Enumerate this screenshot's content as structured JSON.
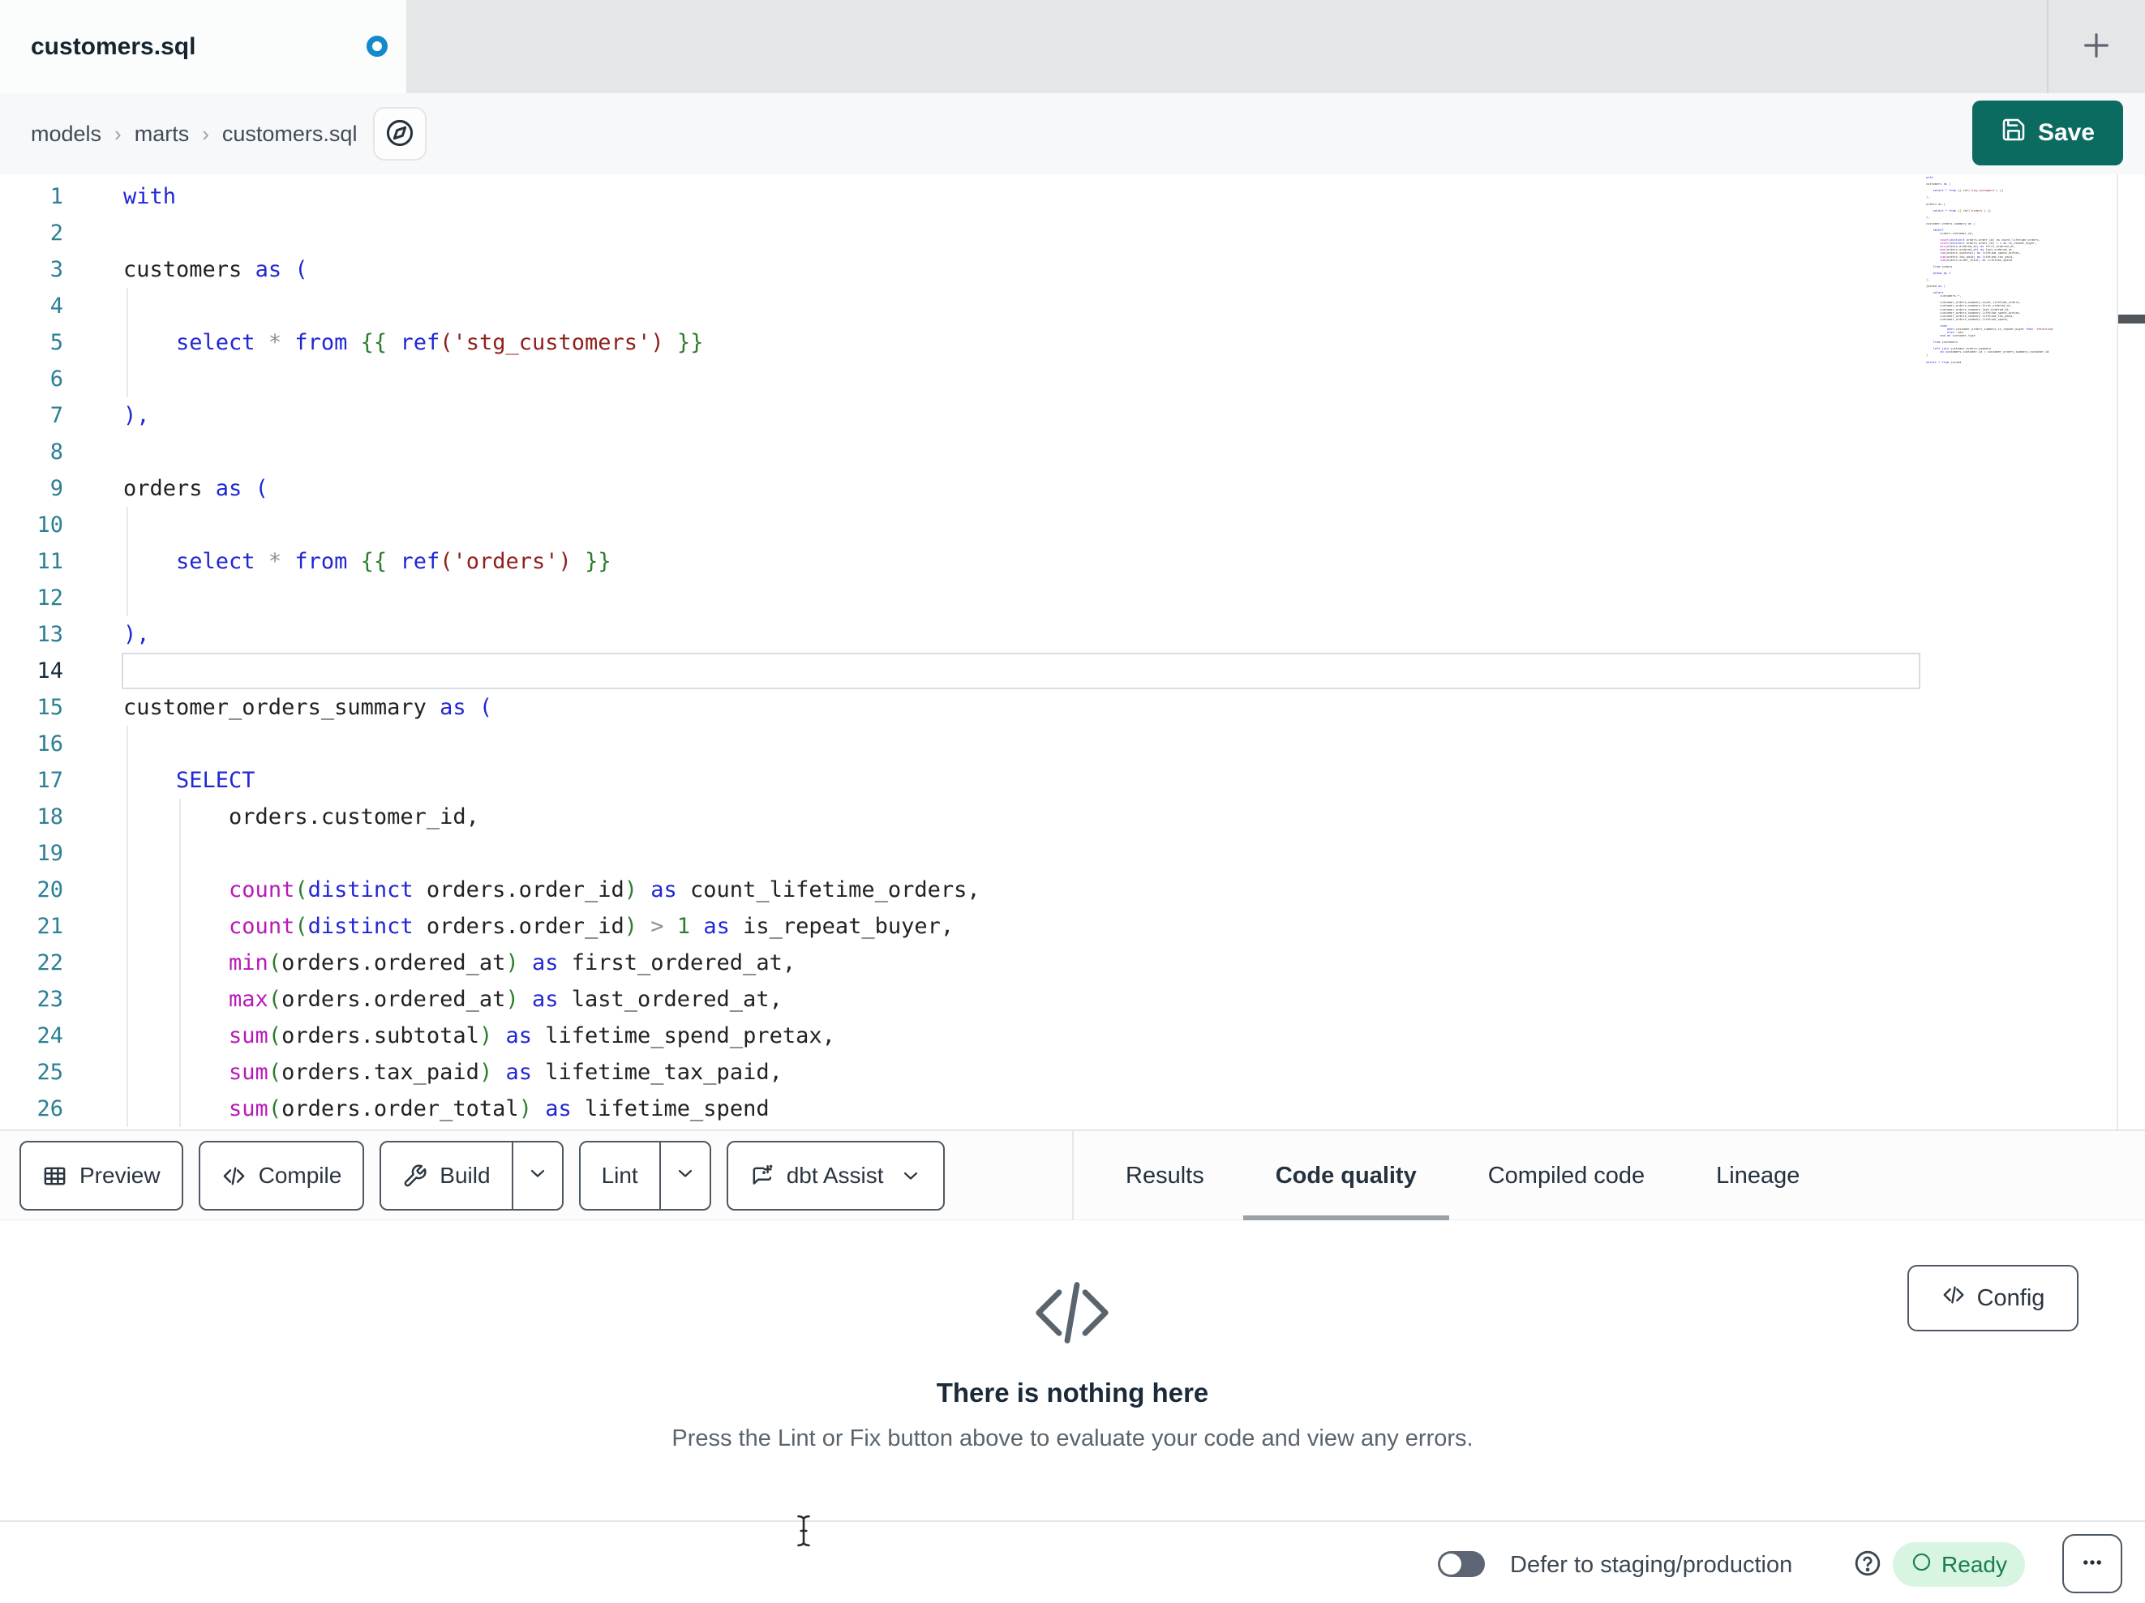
{
  "tab": {
    "title": "customers.sql",
    "dirty": true
  },
  "tabbar": {
    "new_tab_icon": "plus-icon"
  },
  "breadcrumb": {
    "items": [
      "models",
      "marts",
      "customers.sql"
    ],
    "separator": "›",
    "explore_icon": "compass-icon"
  },
  "actions": {
    "save_label": "Save",
    "save_icon": "save-icon"
  },
  "editor": {
    "current_line": 14,
    "lines": [
      {
        "n": 1,
        "t": [
          [
            "k",
            "with"
          ]
        ]
      },
      {
        "n": 2,
        "t": []
      },
      {
        "n": 3,
        "t": [
          [
            "t",
            "customers "
          ],
          [
            "k",
            "as ("
          ]
        ]
      },
      {
        "n": 4,
        "t": []
      },
      {
        "n": 5,
        "t": [
          [
            "t",
            "    "
          ],
          [
            "k",
            "select"
          ],
          [
            "t",
            " "
          ],
          [
            "o",
            "*"
          ],
          [
            "t",
            " "
          ],
          [
            "k",
            "from"
          ],
          [
            "t",
            " "
          ],
          [
            "g",
            "{{"
          ],
          [
            "t",
            " "
          ],
          [
            "k",
            "ref"
          ],
          [
            "s",
            "('stg_customers')"
          ],
          [
            "t",
            " "
          ],
          [
            "g",
            "}}"
          ]
        ]
      },
      {
        "n": 6,
        "t": []
      },
      {
        "n": 7,
        "t": [
          [
            "k",
            "),"
          ]
        ]
      },
      {
        "n": 8,
        "t": []
      },
      {
        "n": 9,
        "t": [
          [
            "t",
            "orders "
          ],
          [
            "k",
            "as ("
          ]
        ]
      },
      {
        "n": 10,
        "t": []
      },
      {
        "n": 11,
        "t": [
          [
            "t",
            "    "
          ],
          [
            "k",
            "select"
          ],
          [
            "t",
            " "
          ],
          [
            "o",
            "*"
          ],
          [
            "t",
            " "
          ],
          [
            "k",
            "from"
          ],
          [
            "t",
            " "
          ],
          [
            "g",
            "{{"
          ],
          [
            "t",
            " "
          ],
          [
            "k",
            "ref"
          ],
          [
            "s",
            "('orders')"
          ],
          [
            "t",
            " "
          ],
          [
            "g",
            "}}"
          ]
        ]
      },
      {
        "n": 12,
        "t": []
      },
      {
        "n": 13,
        "t": [
          [
            "k",
            "),"
          ]
        ]
      },
      {
        "n": 14,
        "t": []
      },
      {
        "n": 15,
        "t": [
          [
            "t",
            "customer_orders_summary "
          ],
          [
            "k",
            "as ("
          ]
        ]
      },
      {
        "n": 16,
        "t": []
      },
      {
        "n": 17,
        "t": [
          [
            "t",
            "    "
          ],
          [
            "k",
            "SELECT"
          ]
        ]
      },
      {
        "n": 18,
        "t": [
          [
            "t",
            "        orders.customer_id,"
          ]
        ]
      },
      {
        "n": 19,
        "t": []
      },
      {
        "n": 20,
        "t": [
          [
            "t",
            "        "
          ],
          [
            "f",
            "count"
          ],
          [
            "g",
            "("
          ],
          [
            "k",
            "distinct"
          ],
          [
            "t",
            " orders.order_id"
          ],
          [
            "g",
            ")"
          ],
          [
            "t",
            " "
          ],
          [
            "k",
            "as"
          ],
          [
            "t",
            " count_lifetime_orders,"
          ]
        ]
      },
      {
        "n": 21,
        "t": [
          [
            "t",
            "        "
          ],
          [
            "f",
            "count"
          ],
          [
            "g",
            "("
          ],
          [
            "k",
            "distinct"
          ],
          [
            "t",
            " orders.order_id"
          ],
          [
            "g",
            ")"
          ],
          [
            "t",
            " "
          ],
          [
            "o",
            ">"
          ],
          [
            "t",
            " "
          ],
          [
            "g",
            "1"
          ],
          [
            "t",
            " "
          ],
          [
            "k",
            "as"
          ],
          [
            "t",
            " is_repeat_buyer,"
          ]
        ]
      },
      {
        "n": 22,
        "t": [
          [
            "t",
            "        "
          ],
          [
            "f",
            "min"
          ],
          [
            "g",
            "("
          ],
          [
            "t",
            "orders.ordered_at"
          ],
          [
            "g",
            ")"
          ],
          [
            "t",
            " "
          ],
          [
            "k",
            "as"
          ],
          [
            "t",
            " first_ordered_at,"
          ]
        ]
      },
      {
        "n": 23,
        "t": [
          [
            "t",
            "        "
          ],
          [
            "f",
            "max"
          ],
          [
            "g",
            "("
          ],
          [
            "t",
            "orders.ordered_at"
          ],
          [
            "g",
            ")"
          ],
          [
            "t",
            " "
          ],
          [
            "k",
            "as"
          ],
          [
            "t",
            " last_ordered_at,"
          ]
        ]
      },
      {
        "n": 24,
        "t": [
          [
            "t",
            "        "
          ],
          [
            "f",
            "sum"
          ],
          [
            "g",
            "("
          ],
          [
            "t",
            "orders.subtotal"
          ],
          [
            "g",
            ")"
          ],
          [
            "t",
            " "
          ],
          [
            "k",
            "as"
          ],
          [
            "t",
            " lifetime_spend_pretax,"
          ]
        ]
      },
      {
        "n": 25,
        "t": [
          [
            "t",
            "        "
          ],
          [
            "f",
            "sum"
          ],
          [
            "g",
            "("
          ],
          [
            "t",
            "orders.tax_paid"
          ],
          [
            "g",
            ")"
          ],
          [
            "t",
            " "
          ],
          [
            "k",
            "as"
          ],
          [
            "t",
            " lifetime_tax_paid,"
          ]
        ]
      },
      {
        "n": 26,
        "t": [
          [
            "t",
            "        "
          ],
          [
            "f",
            "sum"
          ],
          [
            "g",
            "("
          ],
          [
            "t",
            "orders.order_total"
          ],
          [
            "g",
            ")"
          ],
          [
            "t",
            " "
          ],
          [
            "k",
            "as"
          ],
          [
            "t",
            " lifetime_spend"
          ]
        ]
      }
    ],
    "minimap_lines": [
      "with",
      "",
      "customers as (",
      "",
      "    select * from {{ ref('stg_customers') }}",
      "",
      "),",
      "",
      "orders as (",
      "",
      "    select * from {{ ref('orders') }}",
      "",
      "),",
      "",
      "customer_orders_summary as (",
      "",
      "    SELECT",
      "        orders.customer_id,",
      "",
      "        count(distinct orders.order_id) as count_lifetime_orders,",
      "        count(distinct orders.order_id) > 1 as is_repeat_buyer,",
      "        min(orders.ordered_at) as first_ordered_at,",
      "        max(orders.ordered_at) as last_ordered_at,",
      "        sum(orders.subtotal) as lifetime_spend_pretax,",
      "        sum(orders.tax_paid) as lifetime_tax_paid,",
      "        sum(orders.order_total) as lifetime_spend",
      "",
      "    from orders",
      "",
      "    group by 1",
      "",
      "),",
      "",
      "joined as (",
      "",
      "    select",
      "        customers.*,",
      "",
      "        customer_orders_summary.count_lifetime_orders,",
      "        customer_orders_summary.first_ordered_at,",
      "        customer_orders_summary.last_ordered_at,",
      "        customer_orders_summary.lifetime_spend_pretax,",
      "        customer_orders_summary.lifetime_tax_paid,",
      "        customer_orders_summary.lifetime_spend,",
      "",
      "        case",
      "            when customer_orders_summary.is_repeat_buyer then 'returning'",
      "            else 'new'",
      "        end as customer_type",
      "",
      "    from customers",
      "",
      "    left join customer_orders_summary",
      "        on customers.customer_id = customer_orders_summary.customer_id",
      ")",
      "",
      "select * from joined"
    ]
  },
  "toolbar": {
    "buttons": [
      {
        "label": "Preview",
        "icon": "table-icon",
        "split": false,
        "chevron": false
      },
      {
        "label": "Compile",
        "icon": "code-icon",
        "split": false,
        "chevron": false
      },
      {
        "label": "Build",
        "icon": "wrench-icon",
        "split": true,
        "chevron": false
      },
      {
        "label": "Lint",
        "icon": null,
        "split": true,
        "chevron": false
      },
      {
        "label": "dbt Assist",
        "icon": "assist-icon",
        "split": false,
        "chevron": true
      }
    ]
  },
  "result_tabs": [
    {
      "label": "Results",
      "active": false
    },
    {
      "label": "Code quality",
      "active": true
    },
    {
      "label": "Compiled code",
      "active": false
    },
    {
      "label": "Lineage",
      "active": false
    }
  ],
  "panel": {
    "icon": "code-icon",
    "title": "There is nothing here",
    "subtitle": "Press the Lint or Fix button above to evaluate your code and view any errors.",
    "config_label": "Config",
    "config_icon": "code-icon"
  },
  "statusbar": {
    "defer_label": "Defer to staging/production",
    "help_icon": "help-icon",
    "ready_label": "Ready",
    "ready_icon": "circle-icon",
    "more_icon": "ellipsis-icon",
    "toggle_state": "off"
  },
  "colors": {
    "accent_teal": "#0c6b61",
    "dirty_dot_blue": "#1489cb",
    "ready_green": "#18804b",
    "ready_bg": "#d8f5e2"
  }
}
